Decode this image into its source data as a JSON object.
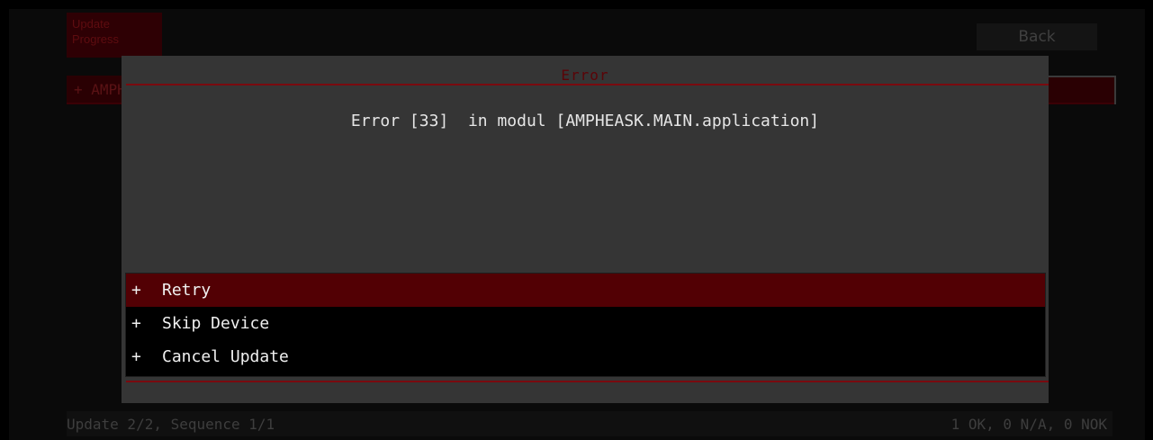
{
  "background": {
    "title_lines": [
      "Update",
      "Progress"
    ],
    "back_label": "Back",
    "list_item_label": "+  AMPHEASK.MAIN",
    "status_left": "Update 2/2, Sequence 1/1",
    "status_right": "1 OK, 0 N/A, 0 NOK"
  },
  "dialog": {
    "title": "Error",
    "message": "Error [33]  in modul [AMPHEASK.MAIN.application]",
    "options": [
      {
        "prefix": "+",
        "label": "Retry",
        "selected": true
      },
      {
        "prefix": "+",
        "label": "Skip Device",
        "selected": false
      },
      {
        "prefix": "+",
        "label": "Cancel Update",
        "selected": false
      }
    ]
  },
  "colors": {
    "accent": "#7a0a0f",
    "selection": "#520004",
    "dialog_bg": "#353535"
  }
}
